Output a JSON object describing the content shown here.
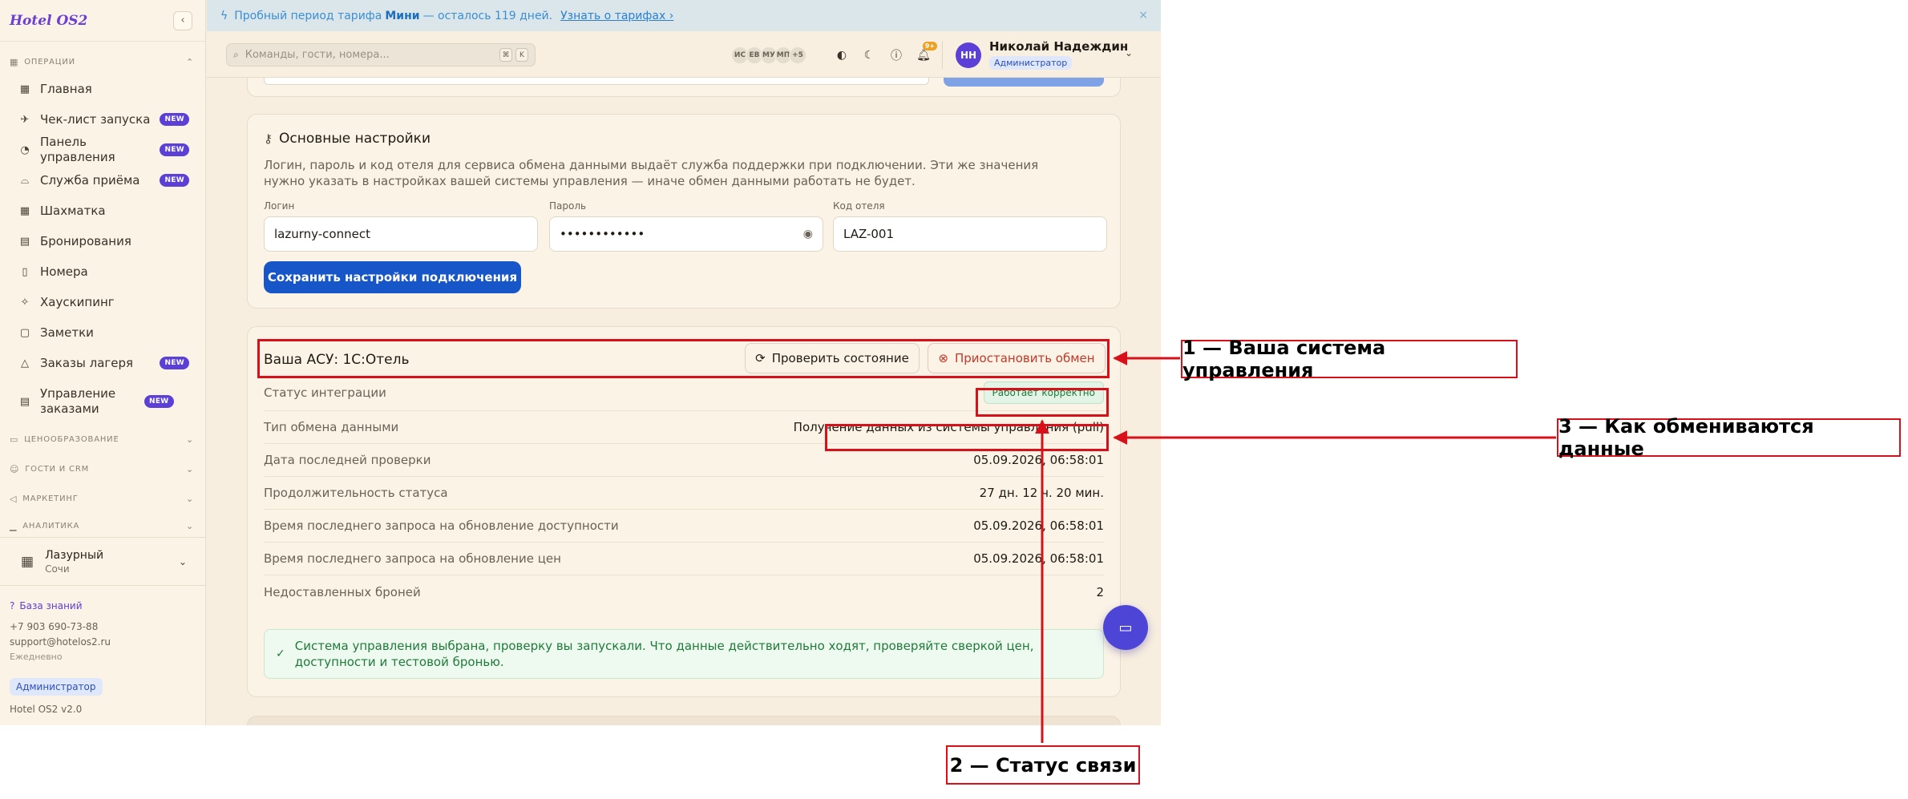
{
  "sidebar": {
    "brand": "Hotel OS2",
    "groups": [
      {
        "label": "ОПЕРАЦИИ",
        "expanded": true
      },
      {
        "label": "ЦЕНООБРАЗОВАНИЕ"
      },
      {
        "label": "ГОСТИ И CRM"
      },
      {
        "label": "МАРКЕТИНГ"
      },
      {
        "label": "АНАЛИТИКА"
      }
    ],
    "items": [
      {
        "label": "Главная",
        "icon": "grid-icon"
      },
      {
        "label": "Чек-лист запуска",
        "icon": "rocket-icon",
        "badge": "NEW"
      },
      {
        "label": "Панель управления",
        "icon": "gauge-icon",
        "badge": "NEW"
      },
      {
        "label": "Служба приёма",
        "icon": "bell-service-icon",
        "badge": "NEW"
      },
      {
        "label": "Шахматка",
        "icon": "table-icon"
      },
      {
        "label": "Бронирования",
        "icon": "clipboard-icon"
      },
      {
        "label": "Номера",
        "icon": "door-icon"
      },
      {
        "label": "Хаускипинг",
        "icon": "sparkles-icon"
      },
      {
        "label": "Заметки",
        "icon": "note-icon"
      },
      {
        "label": "Заказы лагеря",
        "icon": "tent-icon",
        "badge": "NEW"
      },
      {
        "label": "Управление заказами",
        "icon": "list-icon",
        "badge": "NEW"
      }
    ],
    "hotel": {
      "name": "Лазурный",
      "city": "Сочи"
    },
    "footer": {
      "kb_label": "База знаний",
      "phone": "+7 903 690-73-88",
      "email": "support@hotelos2.ru",
      "hours": "Ежедневно",
      "role": "Администратор",
      "version": "Hotel OS2 v2.0"
    }
  },
  "banner": {
    "prefix": "Пробный период тарифа",
    "plan": "Мини",
    "suffix": "— осталось 119 дней.",
    "link": "Узнать о тарифах ›",
    "close": "×"
  },
  "header": {
    "search_placeholder": "Команды, гости, номера...",
    "kbd": [
      "⌘",
      "K"
    ],
    "avatars": [
      "ИС",
      "ЕВ",
      "МУ",
      "МП",
      "+5"
    ],
    "notif_count": "9+",
    "user": {
      "initials": "НН",
      "name": "Николай Надеждин",
      "role": "Администратор"
    }
  },
  "settings": {
    "title": "Основные настройки",
    "description": "Логин, пароль и код отеля для сервиса обмена данными выдаёт служба поддержки при подключении. Эти же значения нужно указать в настройках вашей системы управления — иначе обмен данными работать не будет.",
    "login_label": "Логин",
    "login_value": "lazurny-connect",
    "password_label": "Пароль",
    "password_value": "••••••••••••",
    "code_label": "Код отеля",
    "code_value": "LAZ-001",
    "save_label": "Сохранить настройки подключения"
  },
  "asu": {
    "title": "Ваша АСУ: 1С:Отель",
    "check_label": "Проверить состояние",
    "pause_label": "Приостановить обмен",
    "rows": [
      {
        "label": "Статус интеграции",
        "value": "Работает корректно"
      },
      {
        "label": "Тип обмена данными",
        "value": "Получение данных из системы управления (pull)"
      },
      {
        "label": "Дата последней проверки",
        "value": "05.09.2026, 06:58:01"
      },
      {
        "label": "Продолжительность статуса",
        "value": "27 дн. 12 ч. 20 мин."
      },
      {
        "label": "Время последнего запроса на обновление доступности",
        "value": "05.09.2026, 06:58:01"
      },
      {
        "label": "Время последнего запроса на обновление цен",
        "value": "05.09.2026, 06:58:01"
      },
      {
        "label": "Недоставленных броней",
        "value": "2"
      }
    ],
    "info": "Система управления выбрана, проверку вы запускали. Что данные действительно ходят, проверяйте сверкой цен, доступности и тестовой бронью."
  },
  "annotations": {
    "callout_1": "1 — Ваша система управления",
    "callout_2": "2 — Статус связи",
    "callout_3": "3 — Как обмениваются данные",
    "color": "#d8101a"
  }
}
